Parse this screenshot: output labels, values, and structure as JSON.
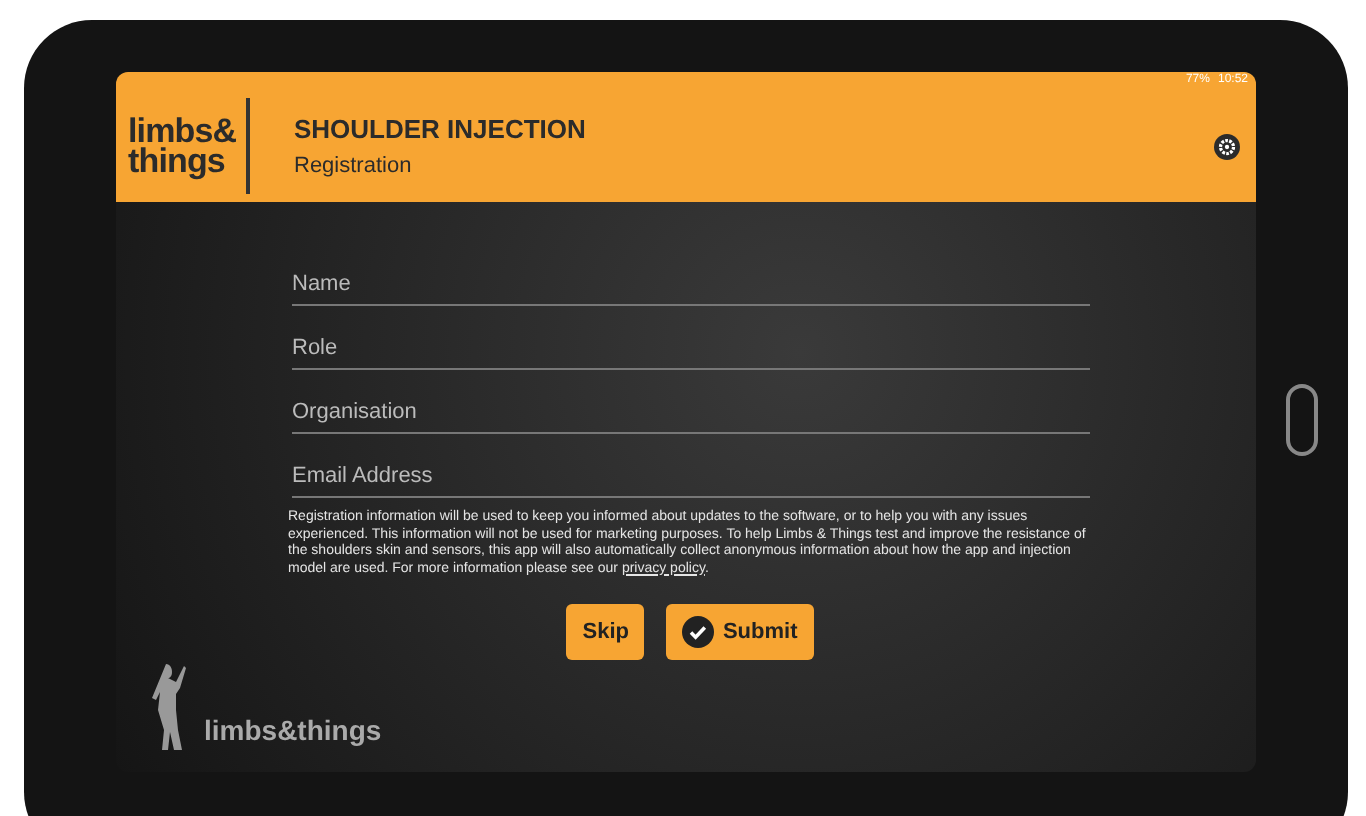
{
  "status_bar": {
    "battery": "77%",
    "time": "10:52"
  },
  "header": {
    "logo_lines": [
      "limbs&",
      "things"
    ],
    "title": "SHOULDER INJECTION",
    "subtitle": "Registration"
  },
  "form": {
    "fields": [
      {
        "placeholder": "Name"
      },
      {
        "placeholder": "Role"
      },
      {
        "placeholder": "Organisation"
      },
      {
        "placeholder": "Email Address"
      }
    ],
    "notice": "Registration information will be used to keep you informed about updates to the software, or to help you with any issues experienced. This information will not be used for marketing purposes. To help Limbs & Things test and improve the resistance of the shoulders skin and sensors, this app will also automatically collect anonymous information about how the app and injection model are used. For more information please see our",
    "notice_link": "privacy policy",
    "notice_end": ".",
    "buttons": [
      {
        "label": "Skip",
        "kind": "plain"
      },
      {
        "label": "Submit",
        "kind": "check"
      }
    ]
  },
  "footer_logo": "limbs&things"
}
